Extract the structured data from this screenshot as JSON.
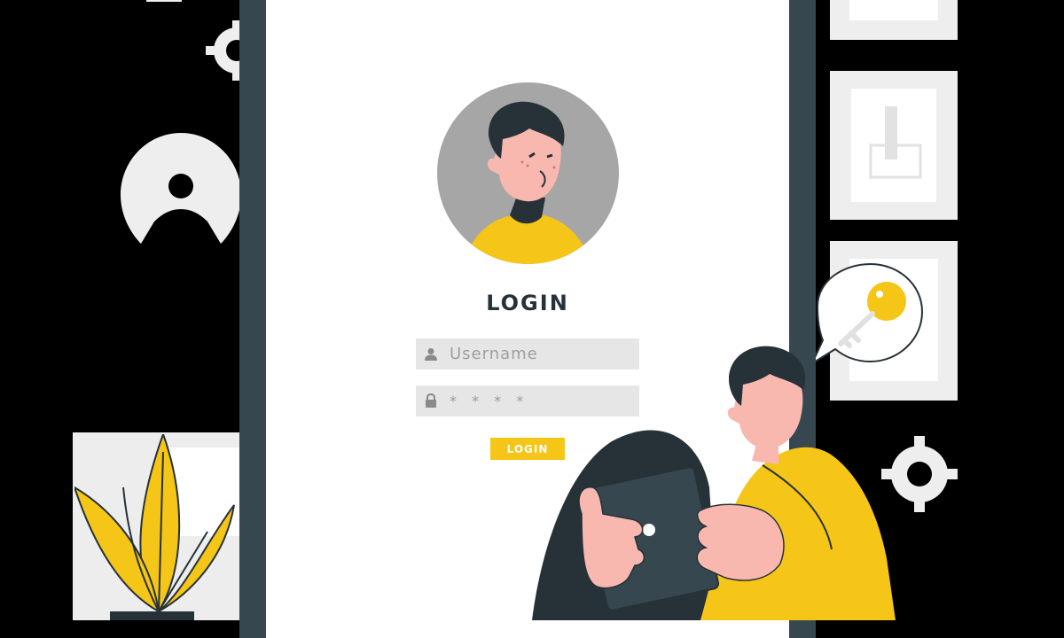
{
  "login": {
    "title": "LOGIN",
    "username_placeholder": "Username",
    "password_mask": "* * * *",
    "button_label": "LOGIN"
  },
  "icons": {
    "username": "user-icon",
    "password": "lock-icon",
    "avatar": "avatar-illustration",
    "key_bubble": "key-icon",
    "gears": "gear-icon"
  },
  "colors": {
    "background": "#000000",
    "phone_frame": "#37474f",
    "screen": "#ffffff",
    "accent_yellow": "#f5c518",
    "input_bg": "#e6e6e6",
    "avatar_bg": "#a6a6a6",
    "skin": "#f8b8b0",
    "hair": "#263238"
  }
}
